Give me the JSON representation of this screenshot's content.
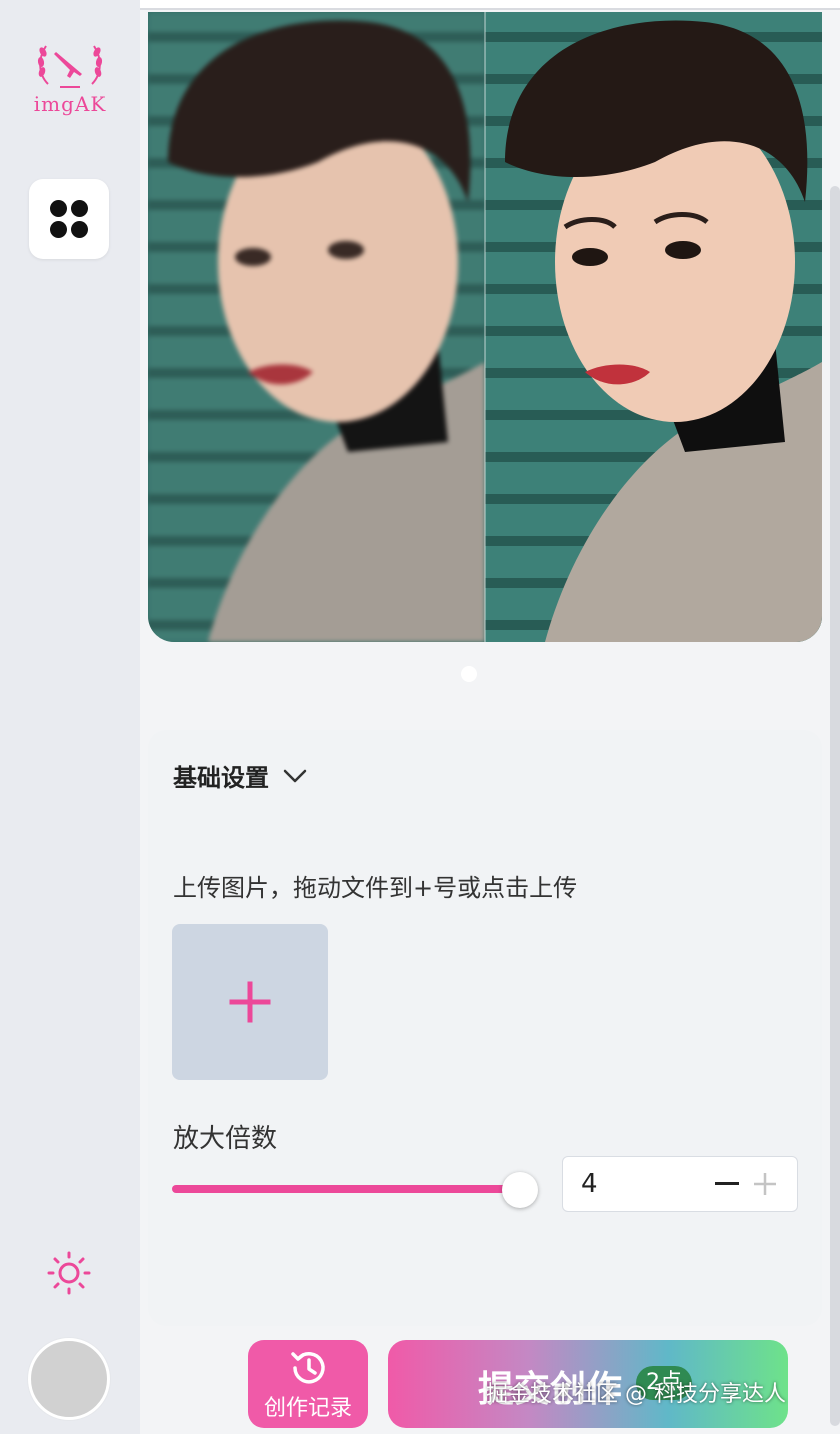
{
  "sidebar": {
    "logo_text": "imgAK",
    "icons": [
      "ak-rifle-laurel-logo",
      "four-leaf-grid-icon",
      "sun-icon",
      "avatar"
    ],
    "accent": "#ec4899"
  },
  "preview": {
    "images": [
      "blurred-portrait-before",
      "sharpened-portrait-after"
    ],
    "active_page": 1,
    "page_count": 1
  },
  "settings": {
    "section_title": "基础设置",
    "upload_label": "上传图片，拖动文件到+号或点击上传",
    "scale_label": "放大倍数",
    "scale_value": "4",
    "scale_fill_fraction": 1.0
  },
  "actions": {
    "history_label": "创作记录",
    "submit_label": "提交创作",
    "cost_badge": "2点",
    "watermark": "掘金技术社区 @ 科技分享达人"
  }
}
